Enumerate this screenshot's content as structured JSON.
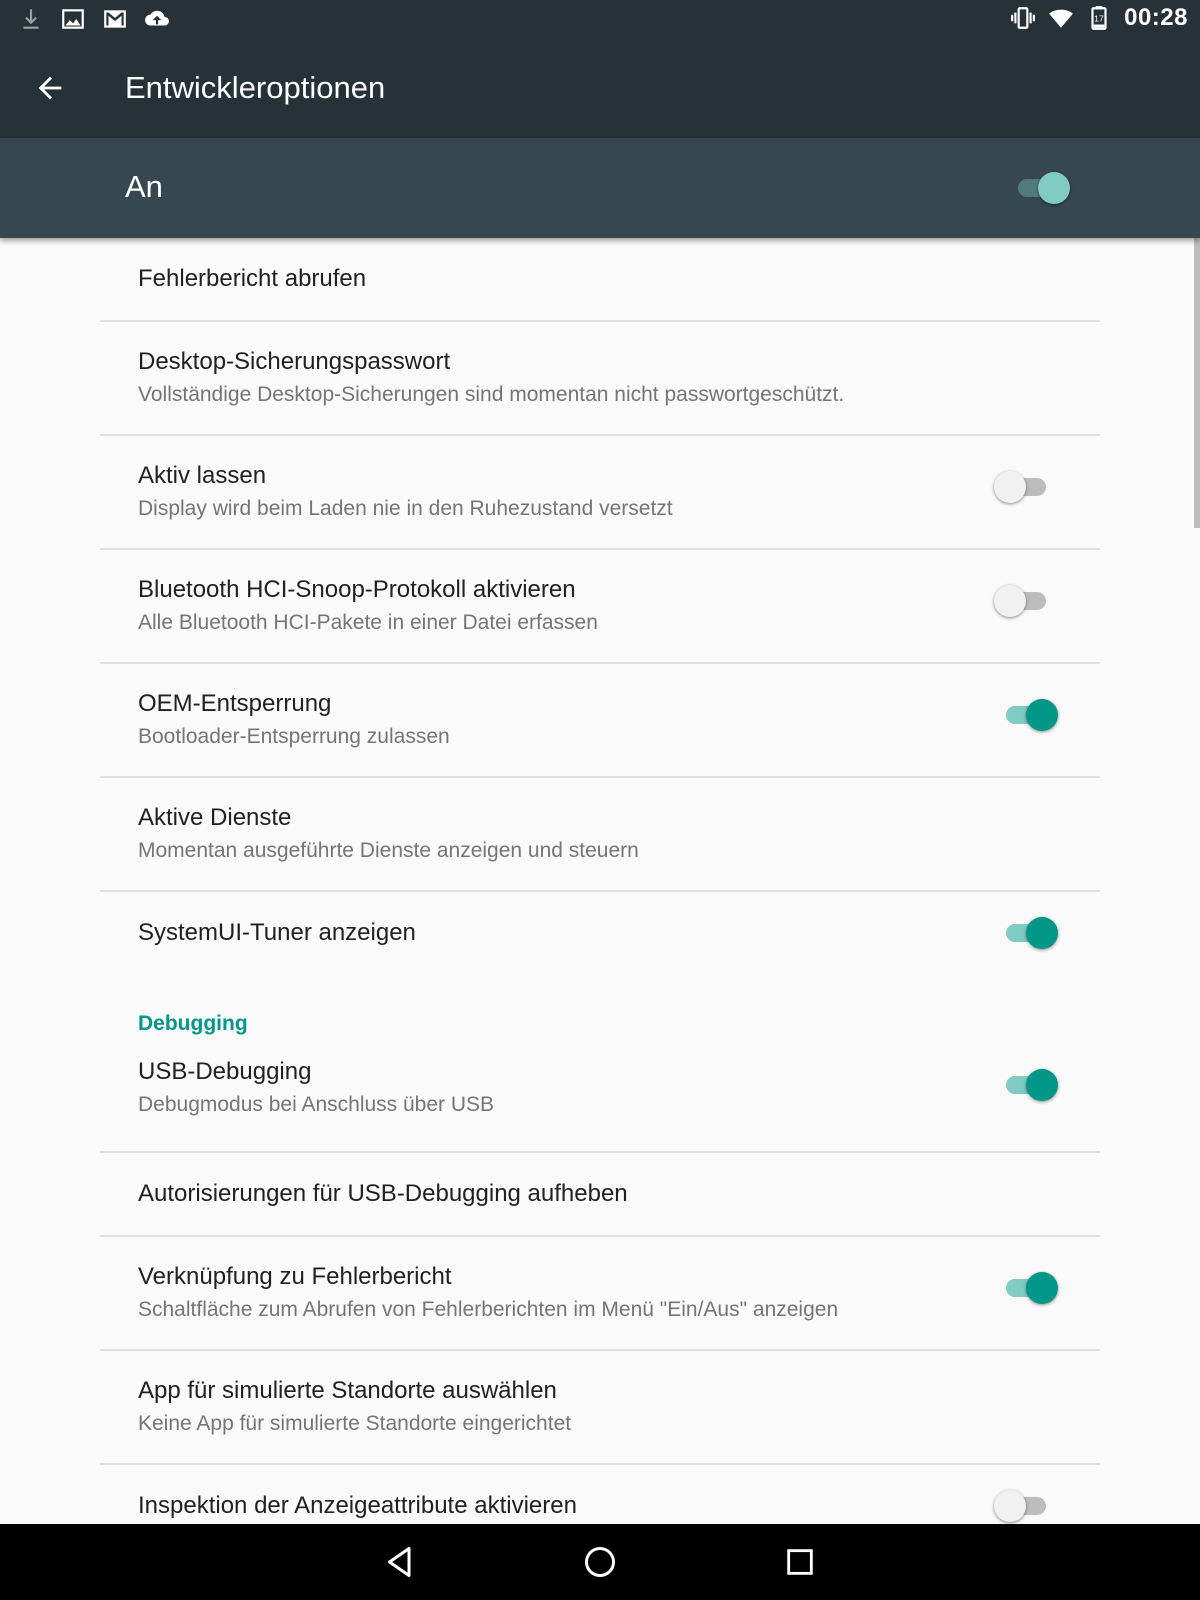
{
  "status_bar": {
    "left_icons": [
      "download-icon",
      "image-icon",
      "gmail-icon",
      "cloud-upload-icon"
    ],
    "right_icons": [
      "vibrate-icon",
      "wifi-icon",
      "battery-icon"
    ],
    "battery_level": "17",
    "time": "00:28"
  },
  "app_bar": {
    "title": "Entwickleroptionen"
  },
  "master_switch": {
    "label": "An",
    "state": true
  },
  "settings": {
    "items": [
      {
        "title": "Fehlerbericht abrufen"
      },
      {
        "title": "Desktop-Sicherungspasswort",
        "summary": "Vollständige Desktop-Sicherungen sind momentan nicht passwortgeschützt."
      },
      {
        "title": "Aktiv lassen",
        "summary": "Display wird beim Laden nie in den Ruhezustand versetzt",
        "switch": false
      },
      {
        "title": "Bluetooth HCI-Snoop-Protokoll aktivieren",
        "summary": "Alle Bluetooth HCI-Pakete in einer Datei erfassen",
        "switch": false
      },
      {
        "title": "OEM-Entsperrung",
        "summary": "Bootloader-Entsperrung zulassen",
        "switch": true
      },
      {
        "title": "Aktive Dienste",
        "summary": "Momentan ausgeführte Dienste anzeigen und steuern"
      },
      {
        "title": "SystemUI-Tuner anzeigen",
        "switch": true
      }
    ],
    "section_debugging": "Debugging",
    "debug_items": [
      {
        "title": "USB-Debugging",
        "summary": "Debugmodus bei Anschluss über USB",
        "switch": true
      },
      {
        "title": "Autorisierungen für USB-Debugging aufheben"
      },
      {
        "title": "Verknüpfung zu Fehlerbericht",
        "summary": "Schaltfläche zum Abrufen von Fehlerberichten im Menü \"Ein/Aus\" anzeigen",
        "switch": true
      },
      {
        "title": "App für simulierte Standorte auswählen",
        "summary": "Keine App für simulierte Standorte eingerichtet"
      },
      {
        "title": "Inspektion der Anzeigeattribute aktivieren",
        "switch": false
      }
    ]
  },
  "colors": {
    "status_bar": "#263238",
    "app_bar": "#263238",
    "master_bar": "#37474f",
    "accent": "#009688",
    "background": "#fafafa"
  },
  "nav_bar": {
    "buttons": [
      "back-triangle-icon",
      "home-circle-icon",
      "recents-square-icon"
    ]
  }
}
